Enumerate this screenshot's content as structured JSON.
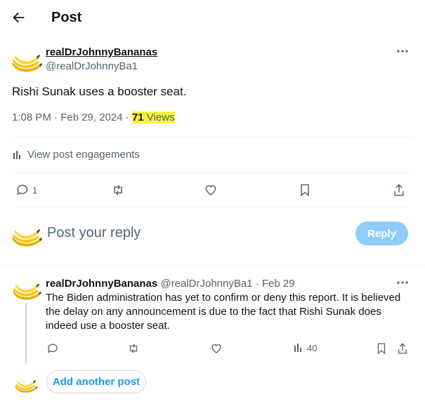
{
  "header": {
    "title": "Post"
  },
  "post": {
    "display_name": "realDrJohnnyBananas",
    "handle": "@realDrJohnnyBa1",
    "text": "Rishi Sunak uses a booster seat.",
    "timestamp": "1:08 PM · Feb 29, 2024 · ",
    "views_count": "71",
    "views_label": " Views",
    "engagements_label": "View post engagements",
    "reply_count": "1"
  },
  "composer": {
    "placeholder": "Post your reply",
    "reply_button": "Reply"
  },
  "reply": {
    "display_name": "realDrJohnnyBananas",
    "handle_date": "@realDrJohnnyBa1 · Feb 29",
    "text": "The Biden administration has yet to confirm or deny this report. It is believed the delay on any announcement is due to the fact that Rishi Sunak does indeed use a booster seat.",
    "views_count": "40"
  },
  "add_another": {
    "label": "Add another post"
  },
  "colors": {
    "accent": "#1d9bf0",
    "reply_button": "#8ecdf8",
    "highlight": "#f7f53a"
  }
}
